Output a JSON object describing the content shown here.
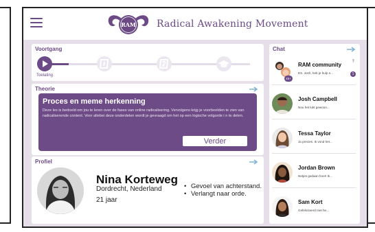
{
  "app": {
    "title": "Radical Awakening Movement",
    "logo_text": "RAM"
  },
  "progress": {
    "title": "Voortgang",
    "current_label": "Toelating",
    "fill_fraction": 0.12,
    "steps": [
      {
        "icon": "play-icon",
        "state": "current"
      },
      {
        "icon": "step-1-icon",
        "state": "locked"
      },
      {
        "icon": "step-2-icon",
        "state": "locked"
      },
      {
        "icon": "graduation-cap-icon",
        "state": "locked"
      }
    ]
  },
  "theory": {
    "title": "Theorie",
    "heading": "Proces en meme herkenning",
    "text": "Deze les is bedoeld om jou te leren over de fases van online radicalisering. Vervolgens krijg je voorbeelden te zien van radicaliserende content. Voor allebei deze onderdelen wordt je gevraagd om het op een logische volgorde i n te delen.",
    "button": "Verder"
  },
  "profile": {
    "title": "Profiel",
    "name": "Nina Korteweg",
    "location": "Dordrecht, Nederland",
    "age": "21 jaar",
    "traits": [
      "Gevoel van achterstand.",
      "Verlangt naar orde."
    ]
  },
  "chat": {
    "title": "Chat",
    "items": [
      {
        "name": "RAM community",
        "preview": "ES. Josh, heb je hulp n...",
        "badge": "45+",
        "unread": "1",
        "pinned": true
      },
      {
        "name": "Josh Campbell",
        "preview": "Nou het lukt gewoon..."
      },
      {
        "name": "Tessa Taylor",
        "preview": "Ja precies. Ik vond het..."
      },
      {
        "name": "Jordan Brown",
        "preview": "Netjes gedaan hoor! Ik..."
      },
      {
        "name": "Sam Kort",
        "preview": "Gefeliciteerd met he..."
      }
    ]
  },
  "colors": {
    "accent": "#6b4a86",
    "background": "#e6dfea",
    "link_arrow": "#7fb3d5"
  }
}
